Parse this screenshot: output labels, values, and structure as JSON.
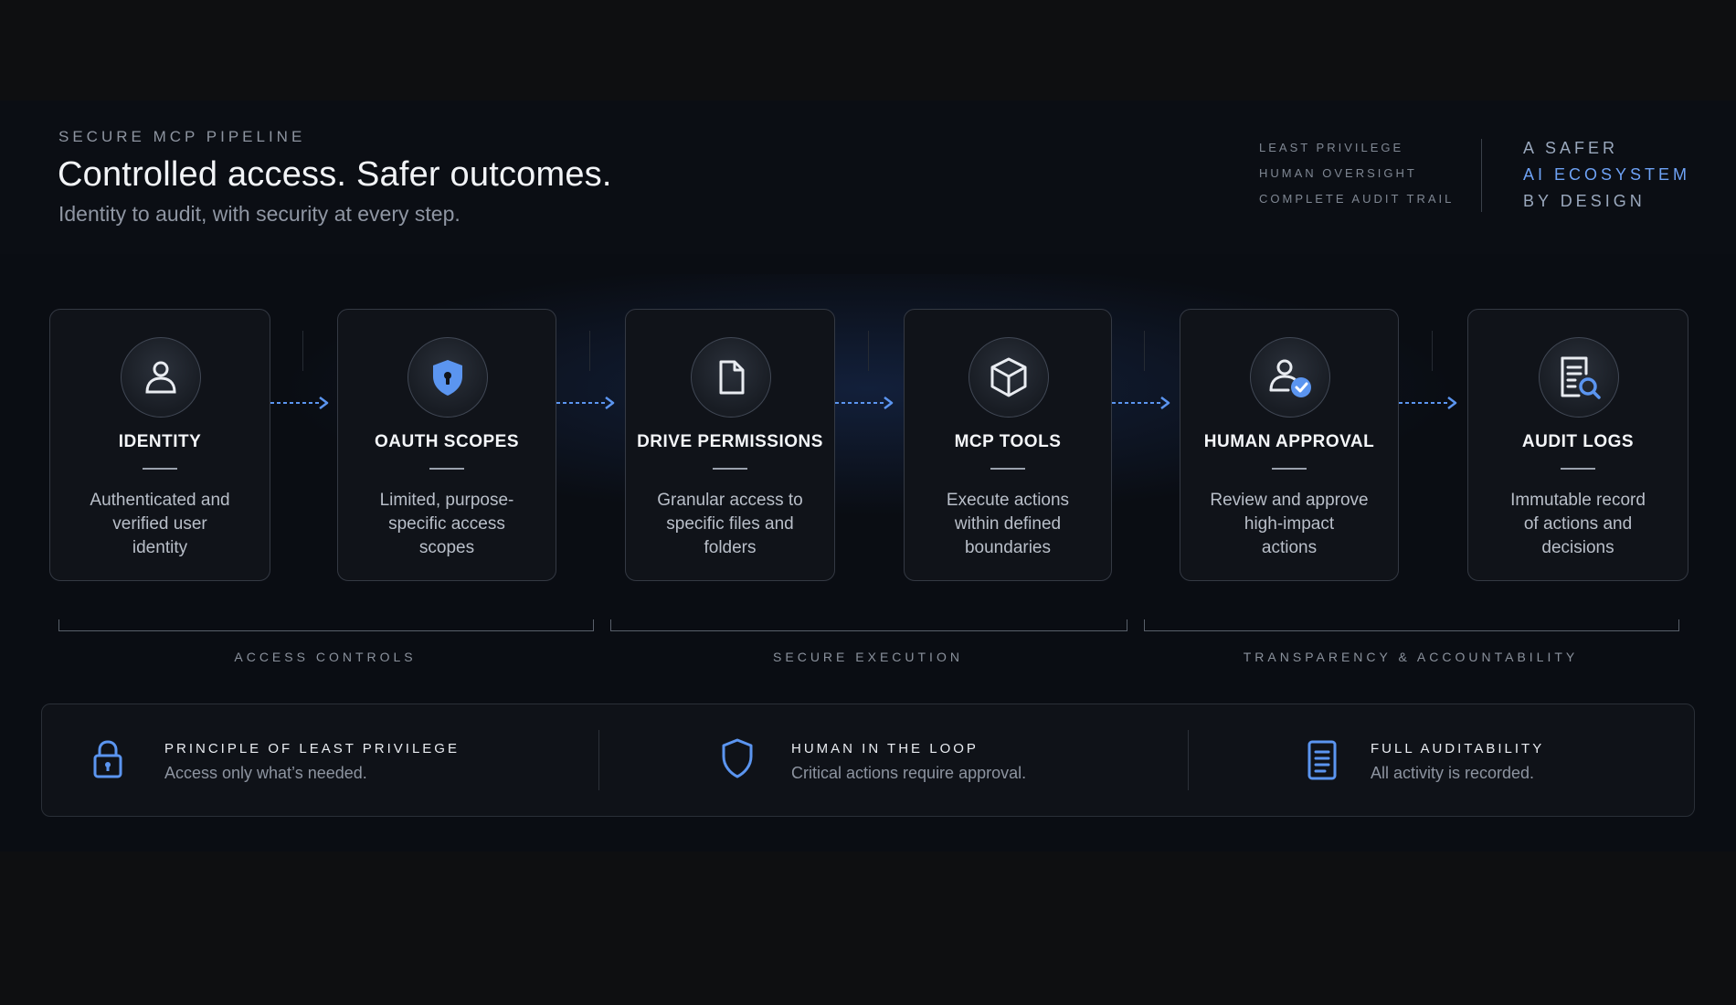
{
  "header": {
    "eyebrow": "SECURE MCP PIPELINE",
    "title": "Controlled access. Safer outcomes.",
    "subtitle": "Identity to audit, with security at every step.",
    "pillars": [
      "LEAST PRIVILEGE",
      "HUMAN OVERSIGHT",
      "COMPLETE AUDIT TRAIL"
    ],
    "tagline": [
      {
        "text": "A SAFER",
        "color": "#9aa8bd"
      },
      {
        "text": "AI ECOSYSTEM",
        "color": "#6ea2f5"
      },
      {
        "text": "BY DESIGN",
        "color": "#9aa8bd"
      }
    ]
  },
  "stages": [
    {
      "title": "IDENTITY",
      "icon": "user-icon",
      "desc": [
        "Authenticated and",
        "verified user",
        "identity"
      ]
    },
    {
      "title": "OAUTH SCOPES",
      "icon": "shield-lock-icon",
      "desc": [
        "Limited, purpose-",
        "specific access",
        "scopes"
      ]
    },
    {
      "title": "DRIVE PERMISSIONS",
      "icon": "file-icon",
      "desc": [
        "Granular access to",
        "specific files and",
        "folders"
      ]
    },
    {
      "title": "MCP TOOLS",
      "icon": "cube-icon",
      "desc": [
        "Execute actions",
        "within defined",
        "boundaries"
      ]
    },
    {
      "title": "HUMAN APPROVAL",
      "icon": "user-check-icon",
      "desc": [
        "Review and approve",
        "high-impact",
        "actions"
      ]
    },
    {
      "title": "AUDIT LOGS",
      "icon": "document-search-icon",
      "desc": [
        "Immutable record",
        "of actions and",
        "decisions"
      ]
    }
  ],
  "groups": [
    "ACCESS CONTROLS",
    "SECURE EXECUTION",
    "TRANSPARENCY & ACCOUNTABILITY"
  ],
  "principles": [
    {
      "title": "PRINCIPLE OF LEAST PRIVILEGE",
      "text": "Access only what’s needed.",
      "icon": "padlock-icon"
    },
    {
      "title": "HUMAN IN THE LOOP",
      "text": "Critical actions require approval.",
      "icon": "shield-icon"
    },
    {
      "title": "FULL AUDITABILITY",
      "text": "All activity is recorded.",
      "icon": "document-icon"
    }
  ],
  "colors": {
    "accent": "#5b95f0",
    "background": "#0e0f11",
    "card": "#101319"
  }
}
